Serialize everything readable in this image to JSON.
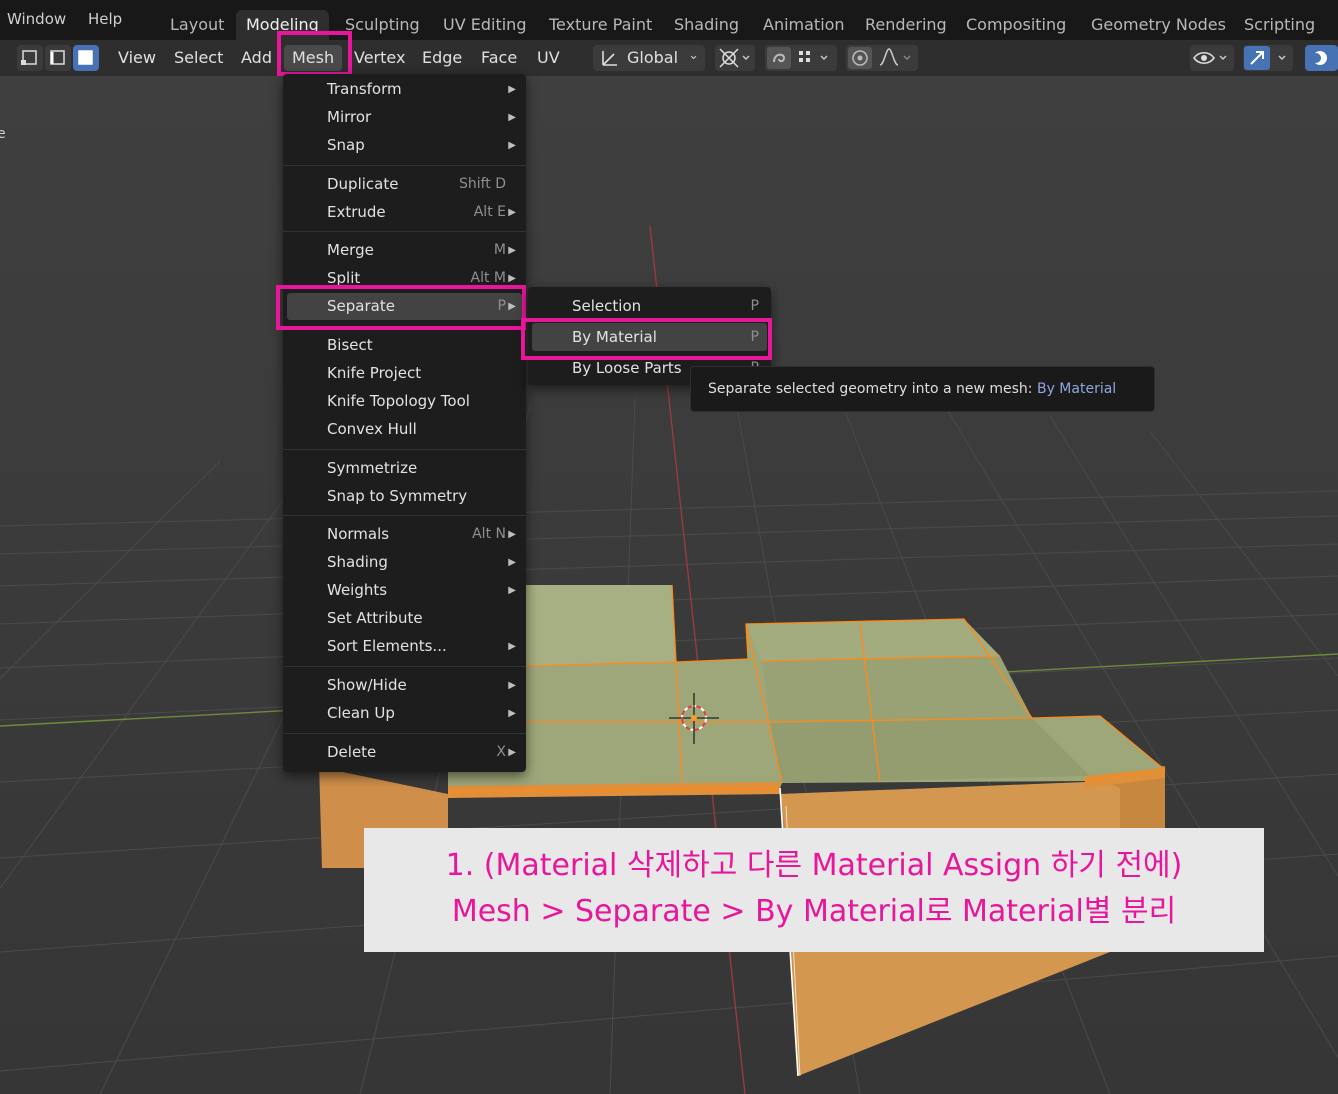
{
  "topbar": {
    "menus": [
      "Window",
      "Help"
    ],
    "workspaces": [
      "Layout",
      "Modeling",
      "Sculpting",
      "UV Editing",
      "Texture Paint",
      "Shading",
      "Animation",
      "Rendering",
      "Compositing",
      "Geometry Nodes",
      "Scripting"
    ],
    "active_workspace": "Modeling"
  },
  "header": {
    "menus": [
      "View",
      "Select",
      "Add",
      "Mesh",
      "Vertex",
      "Edge",
      "Face",
      "UV"
    ],
    "active_menu": "Mesh",
    "transform_orientation": "Global"
  },
  "mesh_menu": {
    "items": [
      {
        "label": "Transform",
        "shortcut": "",
        "submenu": true
      },
      {
        "label": "Mirror",
        "shortcut": "",
        "submenu": true
      },
      {
        "label": "Snap",
        "shortcut": "",
        "submenu": true
      },
      {
        "label": "Duplicate",
        "shortcut": "Shift D",
        "submenu": false
      },
      {
        "label": "Extrude",
        "shortcut": "Alt E",
        "submenu": true
      },
      {
        "label": "Merge",
        "shortcut": "M",
        "submenu": true
      },
      {
        "label": "Split",
        "shortcut": "Alt M",
        "submenu": true
      },
      {
        "label": "Separate",
        "shortcut": "P",
        "submenu": true
      },
      {
        "label": "Bisect",
        "shortcut": "",
        "submenu": false
      },
      {
        "label": "Knife Project",
        "shortcut": "",
        "submenu": false
      },
      {
        "label": "Knife Topology Tool",
        "shortcut": "",
        "submenu": false
      },
      {
        "label": "Convex Hull",
        "shortcut": "",
        "submenu": false
      },
      {
        "label": "Symmetrize",
        "shortcut": "",
        "submenu": false
      },
      {
        "label": "Snap to Symmetry",
        "shortcut": "",
        "submenu": false
      },
      {
        "label": "Normals",
        "shortcut": "Alt N",
        "submenu": true
      },
      {
        "label": "Shading",
        "shortcut": "",
        "submenu": true
      },
      {
        "label": "Weights",
        "shortcut": "",
        "submenu": true
      },
      {
        "label": "Set Attribute",
        "shortcut": "",
        "submenu": false
      },
      {
        "label": "Sort Elements...",
        "shortcut": "",
        "submenu": true
      },
      {
        "label": "Show/Hide",
        "shortcut": "",
        "submenu": true
      },
      {
        "label": "Clean Up",
        "shortcut": "",
        "submenu": true
      },
      {
        "label": "Delete",
        "shortcut": "X",
        "submenu": true
      }
    ]
  },
  "separate_menu": {
    "items": [
      {
        "label": "Selection",
        "shortcut": "P"
      },
      {
        "label": "By Material",
        "shortcut": "P"
      },
      {
        "label": "By Loose Parts",
        "shortcut": "P"
      }
    ]
  },
  "tooltip": {
    "text": "Separate selected geometry into a new mesh:",
    "python": "By Material"
  },
  "caption": {
    "line1": "1. (Material 삭제하고 다른 Material Assign 하기 전에)",
    "line2": "Mesh > Separate > By Material로 Material별 분리"
  },
  "colors": {
    "highlight": "#e8169b",
    "mesh_top": "#9aa574",
    "mesh_side": "#d89a4f",
    "edge": "#ff8a1a"
  }
}
